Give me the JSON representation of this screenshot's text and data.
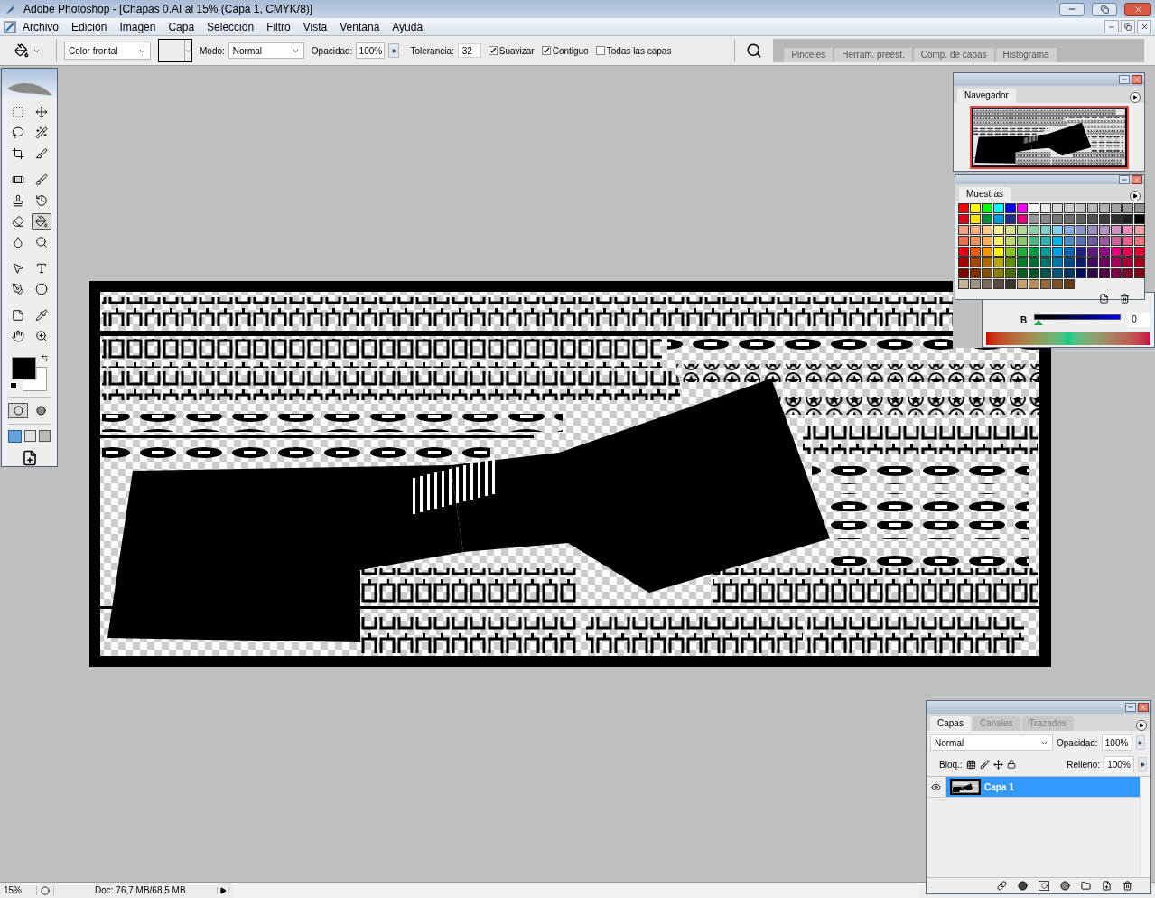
{
  "window": {
    "title": "Adobe Photoshop - [Chapas 0.AI al 15% (Capa 1, CMYK/8)]"
  },
  "menu": [
    "Archivo",
    "Edición",
    "Imagen",
    "Capa",
    "Selección",
    "Filtro",
    "Vista",
    "Ventana",
    "Ayuda"
  ],
  "options_bar": {
    "fill_source": "Color frontal",
    "mode_label": "Modo:",
    "mode": "Normal",
    "opacity_label": "Opacidad:",
    "opacity": "100%",
    "tolerance_label": "Tolerancia:",
    "tolerance": "32",
    "checkboxes": [
      {
        "label": "Suavizar",
        "checked": true
      },
      {
        "label": "Contiguo",
        "checked": true
      },
      {
        "label": "Todas las capas",
        "checked": false
      }
    ]
  },
  "palette_well": [
    "Pinceles",
    "Herram. preest.",
    "Comp. de capas",
    "Histograma"
  ],
  "tools": [
    {
      "kind": "marquee",
      "selected": false
    },
    {
      "kind": "move",
      "selected": false
    },
    {
      "kind": "lasso",
      "selected": false
    },
    {
      "kind": "wand",
      "selected": false
    },
    {
      "kind": "crop",
      "selected": false
    },
    {
      "kind": "slice",
      "selected": false
    },
    {
      "kind": "bandage",
      "selected": false
    },
    {
      "kind": "brush",
      "selected": false
    },
    {
      "kind": "stamp",
      "selected": false
    },
    {
      "kind": "history",
      "selected": false
    },
    {
      "kind": "eraser",
      "selected": false
    },
    {
      "kind": "bucket",
      "selected": true
    },
    {
      "kind": "blur",
      "selected": false
    },
    {
      "kind": "dodge",
      "selected": false
    },
    {
      "kind": "pointer",
      "selected": false
    },
    {
      "kind": "type",
      "selected": false
    },
    {
      "kind": "pen",
      "selected": false
    },
    {
      "kind": "ellipse",
      "selected": false
    },
    {
      "kind": "notes",
      "selected": false
    },
    {
      "kind": "eyedropper",
      "selected": false
    },
    {
      "kind": "hand",
      "selected": false
    },
    {
      "kind": "zoom",
      "selected": false
    }
  ],
  "navigator": {
    "title": "Navegador"
  },
  "swatches": {
    "title": "Muestras",
    "items": [
      {
        "color": "#ff0000"
      },
      {
        "color": "#ffff00"
      },
      {
        "color": "#00ff00"
      },
      {
        "color": "#00ffff"
      },
      {
        "color": "#0000ff"
      },
      {
        "color": "#ff00ff"
      },
      {
        "color": "#ffffff"
      },
      {
        "color": "#ebebeb"
      },
      {
        "color": "#d7d7d7"
      },
      {
        "color": "#cdcdcd"
      },
      {
        "color": "#c3c3c3"
      },
      {
        "color": "#b9b9b9"
      },
      {
        "color": "#afafaf"
      },
      {
        "color": "#a5a5a5"
      },
      {
        "color": "#9b9b9b"
      },
      {
        "color": "#919191"
      },
      {
        "color": "#e0001b"
      },
      {
        "color": "#ffe600"
      },
      {
        "color": "#008c3c"
      },
      {
        "color": "#009bdc"
      },
      {
        "color": "#1e2d8c"
      },
      {
        "color": "#e6007e"
      },
      {
        "color": "#969696"
      },
      {
        "color": "#8c8c8c"
      },
      {
        "color": "#787878"
      },
      {
        "color": "#6e6e6e"
      },
      {
        "color": "#5f5f5f"
      },
      {
        "color": "#505050"
      },
      {
        "color": "#3c3c3c"
      },
      {
        "color": "#2d2d2d"
      },
      {
        "color": "#1e1e1e"
      },
      {
        "color": "#000000"
      },
      {
        "color": "#f29c80"
      },
      {
        "color": "#f7b084"
      },
      {
        "color": "#fcc98c"
      },
      {
        "color": "#fff29a"
      },
      {
        "color": "#d7e08c"
      },
      {
        "color": "#b4d79a"
      },
      {
        "color": "#8ccba0"
      },
      {
        "color": "#82cdc8"
      },
      {
        "color": "#82d2f0"
      },
      {
        "color": "#87aadc"
      },
      {
        "color": "#8c96c8"
      },
      {
        "color": "#9b8cc3"
      },
      {
        "color": "#b491c3"
      },
      {
        "color": "#d291c3"
      },
      {
        "color": "#f08cb4"
      },
      {
        "color": "#f0a0a0"
      },
      {
        "color": "#ee6e50"
      },
      {
        "color": "#f3915a"
      },
      {
        "color": "#f9b15a"
      },
      {
        "color": "#fff05f"
      },
      {
        "color": "#bed76e"
      },
      {
        "color": "#8cc86e"
      },
      {
        "color": "#50b482"
      },
      {
        "color": "#2db4ae"
      },
      {
        "color": "#00b4e6"
      },
      {
        "color": "#4b8cc8"
      },
      {
        "color": "#5a6eb4"
      },
      {
        "color": "#6e5aa5"
      },
      {
        "color": "#9b5aa5"
      },
      {
        "color": "#c8649b"
      },
      {
        "color": "#eb5f8c"
      },
      {
        "color": "#eb7378"
      },
      {
        "color": "#e60019"
      },
      {
        "color": "#ea5a0f"
      },
      {
        "color": "#f39800"
      },
      {
        "color": "#fff100"
      },
      {
        "color": "#8fc31f"
      },
      {
        "color": "#22ac38"
      },
      {
        "color": "#009944"
      },
      {
        "color": "#009e96"
      },
      {
        "color": "#00a0e9"
      },
      {
        "color": "#0068b7"
      },
      {
        "color": "#1d2088"
      },
      {
        "color": "#601986"
      },
      {
        "color": "#920783"
      },
      {
        "color": "#e4007f"
      },
      {
        "color": "#e5004f"
      },
      {
        "color": "#e60033"
      },
      {
        "color": "#a40000"
      },
      {
        "color": "#a84200"
      },
      {
        "color": "#ac6a00"
      },
      {
        "color": "#b5a800"
      },
      {
        "color": "#638c0b"
      },
      {
        "color": "#0c7a2a"
      },
      {
        "color": "#006934"
      },
      {
        "color": "#00736d"
      },
      {
        "color": "#0075a9"
      },
      {
        "color": "#004986"
      },
      {
        "color": "#0e1b6e"
      },
      {
        "color": "#440962"
      },
      {
        "color": "#6a005f"
      },
      {
        "color": "#a4005b"
      },
      {
        "color": "#a40035"
      },
      {
        "color": "#a4001d"
      },
      {
        "color": "#7d0000"
      },
      {
        "color": "#7f2d00"
      },
      {
        "color": "#835000"
      },
      {
        "color": "#8a8000"
      },
      {
        "color": "#4d6a08"
      },
      {
        "color": "#005e1e"
      },
      {
        "color": "#005127"
      },
      {
        "color": "#005752"
      },
      {
        "color": "#00587f"
      },
      {
        "color": "#003967"
      },
      {
        "color": "#000e56"
      },
      {
        "color": "#30054a"
      },
      {
        "color": "#500049"
      },
      {
        "color": "#7e0047"
      },
      {
        "color": "#7e0027"
      },
      {
        "color": "#7e0011"
      },
      {
        "color": "#c8b496"
      },
      {
        "color": "#a09080"
      },
      {
        "color": "#7d6b5a"
      },
      {
        "color": "#5a4b3c"
      },
      {
        "color": "#3c3228"
      },
      {
        "color": "#c8a06e"
      },
      {
        "color": "#b48c5a"
      },
      {
        "color": "#96693c"
      },
      {
        "color": "#7d5028"
      },
      {
        "color": "#643c14"
      }
    ]
  },
  "color_panel": {
    "channel": "B",
    "value": "0"
  },
  "layers": {
    "tabs": [
      {
        "label": "Capas",
        "selected": true
      },
      {
        "label": "Canales",
        "selected": false
      },
      {
        "label": "Trazados",
        "selected": false
      }
    ],
    "blend_mode": "Normal",
    "opacity_label": "Opacidad:",
    "opacity": "100%",
    "lock_label": "Bloq.:",
    "fill_label": "Relleno:",
    "fill": "100%",
    "items": [
      {
        "name": "Capa 1",
        "selected": true,
        "visible": true
      }
    ]
  },
  "status_bar": {
    "zoom": "15%",
    "doc": "Doc: 76,7 MB/68,5 MB"
  }
}
